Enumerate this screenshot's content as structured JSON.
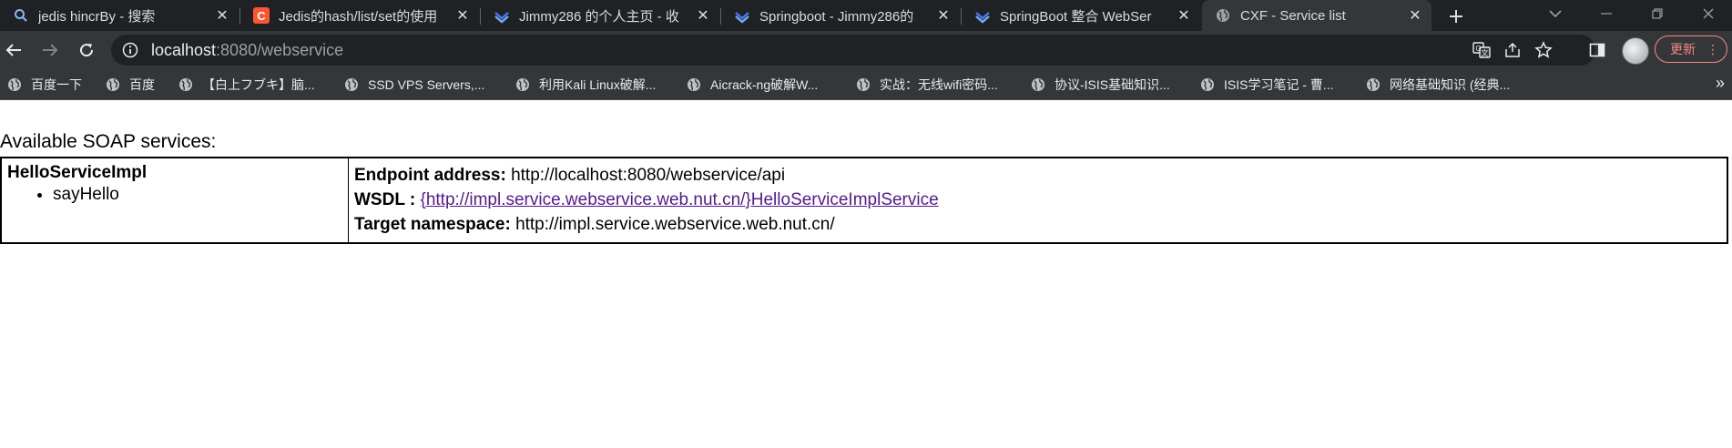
{
  "browser": {
    "tabs": [
      {
        "title": "jedis hincrBy - 搜索",
        "icon": "search-icon",
        "active": false
      },
      {
        "title": "Jedis的hash/list/set的使用",
        "icon": "csdn-icon",
        "active": false
      },
      {
        "title": "Jimmy286 的个人主页 - 收",
        "icon": "brand-icon",
        "active": false
      },
      {
        "title": "Springboot - Jimmy286的",
        "icon": "brand-icon",
        "active": false
      },
      {
        "title": "SpringBoot 整合 WebSer",
        "icon": "brand-icon",
        "active": false
      },
      {
        "title": "CXF - Service list",
        "icon": "globe-icon",
        "active": true
      }
    ],
    "url_host": "localhost",
    "url_rest": ":8080/webservice",
    "update_label": "更新",
    "bookmarks": [
      "百度一下",
      "百度",
      "【白上フブキ】脑...",
      "SSD VPS Servers,...",
      "利用Kali Linux破解...",
      "Aicrack-ng破解W...",
      "实战：无线wifi密码...",
      "协议-ISIS基础知识...",
      "ISIS学习笔记 - 曹...",
      "网络基础知识 (经典..."
    ],
    "bookmarks_more": "»",
    "colors": {
      "tab_bar": "#202124",
      "toolbar": "#35363a",
      "update_accent": "#f28b82",
      "link_visited": "#551a8b"
    }
  },
  "page": {
    "heading": "Available SOAP services:",
    "services": [
      {
        "name": "HelloServiceImpl",
        "operations": [
          "sayHello"
        ],
        "endpoint_label": "Endpoint address:",
        "endpoint": "http://localhost:8080/webservice/api",
        "wsdl_label": "WSDL :",
        "wsdl": "{http://impl.service.webservice.web.nut.cn/}HelloServiceImplService",
        "namespace_label": "Target namespace:",
        "namespace": "http://impl.service.webservice.web.nut.cn/"
      }
    ]
  }
}
